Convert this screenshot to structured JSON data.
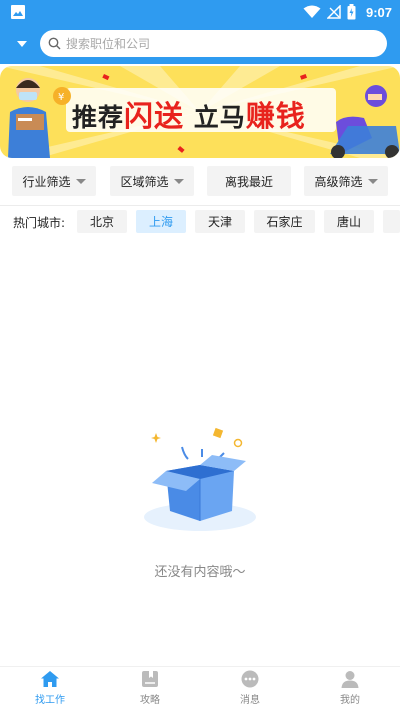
{
  "status_bar": {
    "time": "9:07"
  },
  "search": {
    "placeholder": "搜索职位和公司"
  },
  "banner": {
    "title_part1": "推荐",
    "title_red1": "闪送",
    "title_part2": "立马",
    "title_red2": "赚钱"
  },
  "filters": [
    {
      "label": "行业筛选",
      "has_caret": true
    },
    {
      "label": "区域筛选",
      "has_caret": true
    },
    {
      "label": "离我最近",
      "has_caret": false
    },
    {
      "label": "高级筛选",
      "has_caret": true
    }
  ],
  "hot_cities": {
    "label": "热门城市:",
    "items": [
      "北京",
      "上海",
      "天津",
      "石家庄",
      "唐山"
    ],
    "selected": "上海"
  },
  "empty_state": {
    "text": "还没有内容哦～"
  },
  "tabbar": {
    "items": [
      {
        "label": "找工作",
        "icon": "home-icon"
      },
      {
        "label": "攻略",
        "icon": "book-icon"
      },
      {
        "label": "消息",
        "icon": "chat-icon"
      },
      {
        "label": "我的",
        "icon": "user-icon"
      }
    ],
    "active": "找工作"
  },
  "colors": {
    "primary": "#2f9bf0",
    "banner_bg": "#fde05a",
    "accent_red": "#e8231d"
  }
}
